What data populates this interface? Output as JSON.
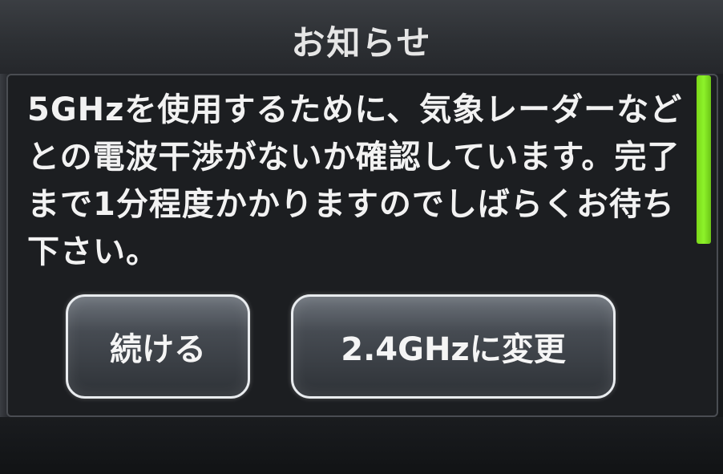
{
  "title": "お知らせ",
  "message": "5GHzを使用するために、気象レーダーなどとの電波干渉がないか確認しています。完了まで1分程度かかりますのでしばらくお待ち下さい。",
  "buttons": {
    "continue_label": "続ける",
    "change_label": "2.4GHzに変更"
  },
  "colors": {
    "scroll_indicator": "#8df22a",
    "background": "#151719",
    "text": "#f2f2f2"
  }
}
